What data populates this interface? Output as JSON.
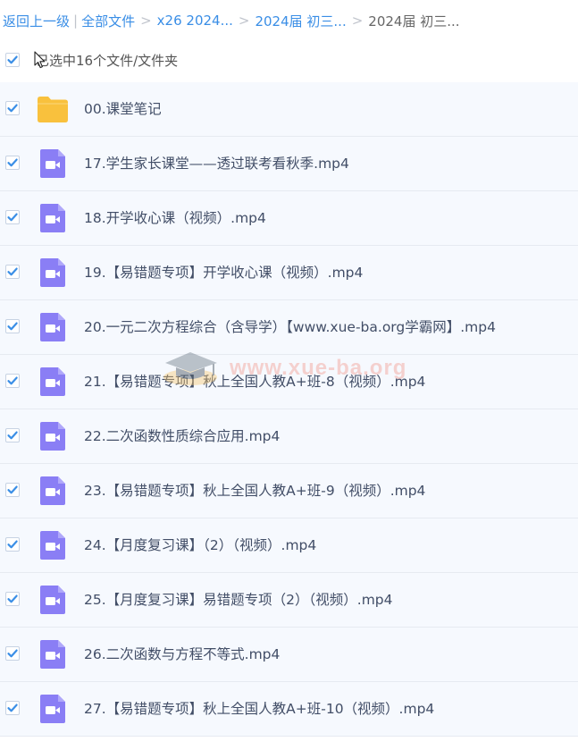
{
  "breadcrumb": {
    "back": "返回上一级",
    "all_files": "全部文件",
    "level1": "x26 2024...",
    "level2": "2024届 初三...",
    "current": "2024届 初三..."
  },
  "selection": {
    "label": "已选中16个文件/文件夹",
    "checked": true
  },
  "colors": {
    "accent": "#3a8ee6",
    "folder": "#f9c13d",
    "video": "#8a7ef5"
  },
  "files": [
    {
      "name": "00.课堂笔记",
      "type": "folder-icon",
      "checked": true
    },
    {
      "name": "17.学生家长课堂——透过联考看秋季.mp4",
      "type": "video-file-icon",
      "checked": true
    },
    {
      "name": "18.开学收心课（视频）.mp4",
      "type": "video-file-icon",
      "checked": true
    },
    {
      "name": "19.【易错题专项】开学收心课（视频）.mp4",
      "type": "video-file-icon",
      "checked": true
    },
    {
      "name": "20.一元二次方程综合（含导学）【www.xue-ba.org学霸网】.mp4",
      "type": "video-file-icon",
      "checked": true
    },
    {
      "name": "21.【易错题专项】秋上全国人教A+班-8（视频）.mp4",
      "type": "video-file-icon",
      "checked": true
    },
    {
      "name": "22.二次函数性质综合应用.mp4",
      "type": "video-file-icon",
      "checked": true
    },
    {
      "name": "23.【易错题专项】秋上全国人教A+班-9（视频）.mp4",
      "type": "video-file-icon",
      "checked": true
    },
    {
      "name": "24.【月度复习课】（2）（视频）.mp4",
      "type": "video-file-icon",
      "checked": true
    },
    {
      "name": "25.【月度复习课】易错题专项（2）（视频）.mp4",
      "type": "video-file-icon",
      "checked": true
    },
    {
      "name": "26.二次函数与方程不等式.mp4",
      "type": "video-file-icon",
      "checked": true
    },
    {
      "name": "27.【易错题专项】秋上全国人教A+班-10（视频）.mp4",
      "type": "video-file-icon",
      "checked": true
    }
  ],
  "watermark": "www.xue-ba.org"
}
